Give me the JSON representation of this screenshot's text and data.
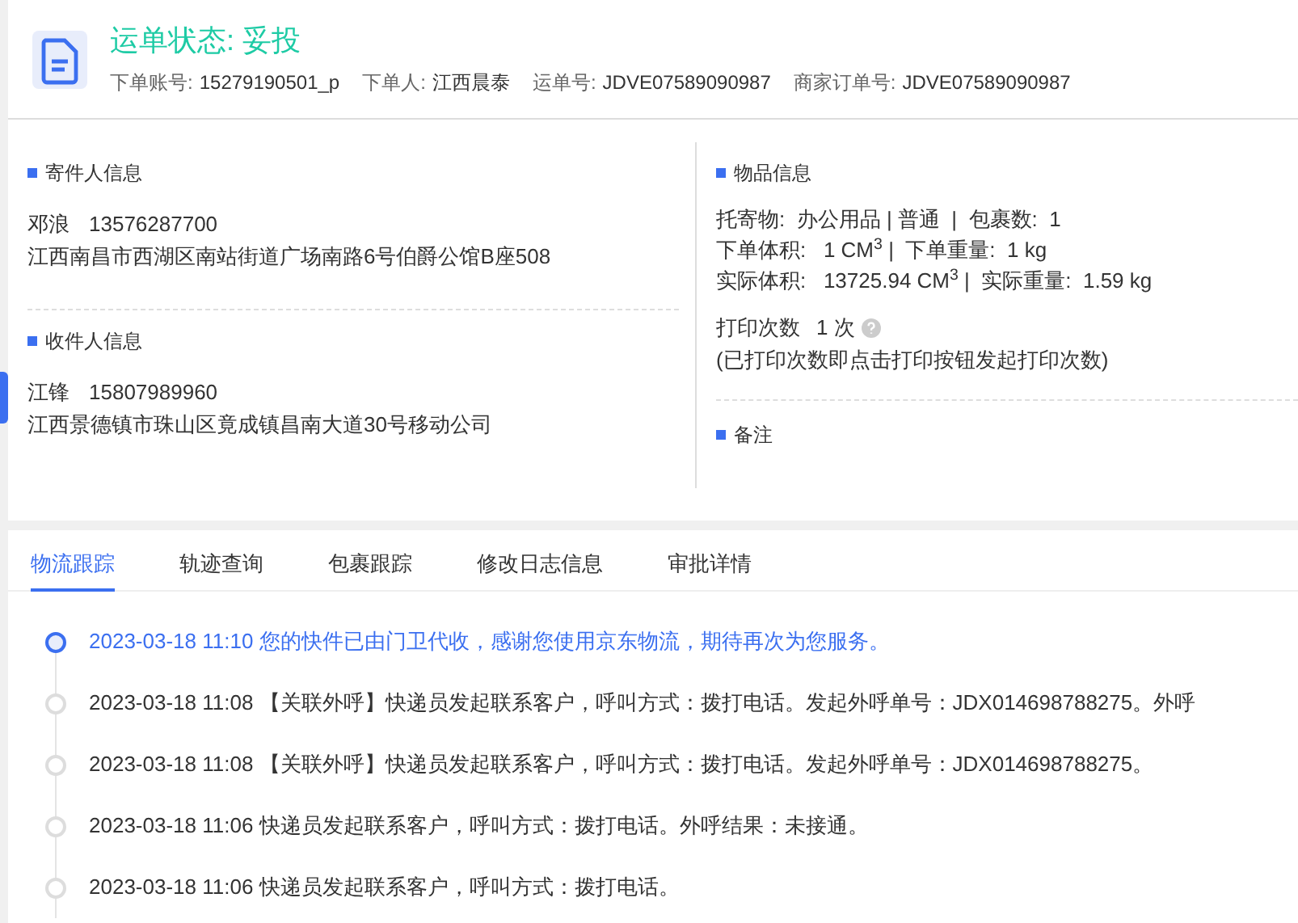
{
  "header": {
    "title": "运单状态: 妥投",
    "fields": [
      {
        "label": "下单账号:",
        "value": "15279190501_p"
      },
      {
        "label": "下单人:",
        "value": "江西晨泰"
      },
      {
        "label": "运单号:",
        "value": "JDVE07589090987"
      },
      {
        "label": "商家订单号:",
        "value": "JDVE07589090987"
      }
    ]
  },
  "sender": {
    "heading": "寄件人信息",
    "name": "邓浪",
    "phone": "13576287700",
    "address": "江西南昌市西湖区南站街道广场南路6号伯爵公馆B座508"
  },
  "receiver": {
    "heading": "收件人信息",
    "name": "江锋",
    "phone": "15807989960",
    "address": "江西景德镇市珠山区竟成镇昌南大道30号移动公司"
  },
  "goods": {
    "heading": "物品信息",
    "lines": [
      "托寄物:  办公用品 | 普通  |  包裹数:  1",
      "下单体积:   1 CM$^{3}$ |  下单重量:  1 kg",
      "实际体积:   13725.94 CM$^{3}$ |  实际重量:  1.59 kg"
    ],
    "print_label": "打印次数",
    "print_count": "1 次",
    "print_note": "(已打印次数即点击打印按钮发起打印次数)"
  },
  "remarks": {
    "heading": "备注"
  },
  "tabs": [
    {
      "label": "物流跟踪",
      "selected": true
    },
    {
      "label": "轨迹查询",
      "selected": false
    },
    {
      "label": "包裹跟踪",
      "selected": false
    },
    {
      "label": "修改日志信息",
      "selected": false
    },
    {
      "label": "审批详情",
      "selected": false
    }
  ],
  "timeline": [
    {
      "text": "2023-03-18 11:10 您的快件已由门卫代收，感谢您使用京东物流，期待再次为您服务。",
      "current": true
    },
    {
      "text": "2023-03-18 11:08 【关联外呼】快递员发起联系客户，呼叫方式：拨打电话。发起外呼单号：JDX014698788275。外呼",
      "current": false
    },
    {
      "text": "2023-03-18 11:08 【关联外呼】快递员发起联系客户，呼叫方式：拨打电话。发起外呼单号：JDX014698788275。",
      "current": false
    },
    {
      "text": "2023-03-18 11:06 快递员发起联系客户，呼叫方式：拨打电话。外呼结果：未接通。",
      "current": false
    },
    {
      "text": "2023-03-18 11:06 快递员发起联系客户，呼叫方式：拨打电话。",
      "current": false
    }
  ]
}
